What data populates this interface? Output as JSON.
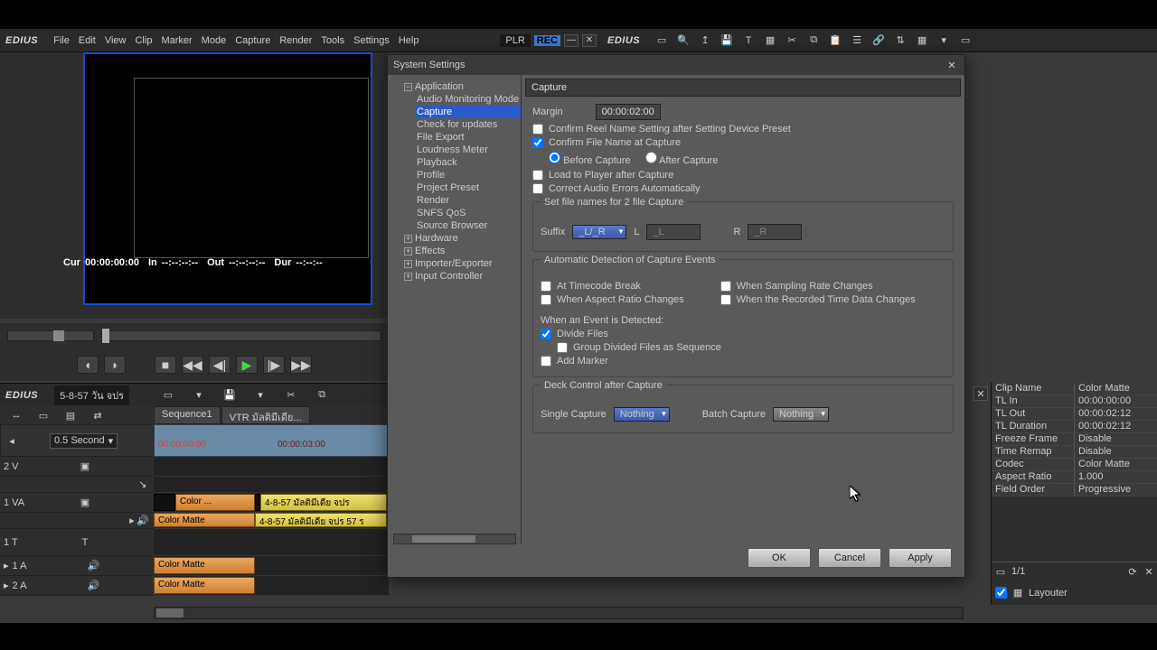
{
  "app": {
    "brand": "EDIUS"
  },
  "menu": [
    "File",
    "Edit",
    "View",
    "Clip",
    "Marker",
    "Mode",
    "Capture",
    "Render",
    "Tools",
    "Settings",
    "Help"
  ],
  "titlebar": {
    "plr": "PLR",
    "rec": "REC"
  },
  "preview": {
    "cur_lbl": "Cur",
    "cur": "00:00:00:00",
    "in_lbl": "In",
    "in": "--:--:--:--",
    "out_lbl": "Out",
    "out": "--:--:--:--",
    "dur_lbl": "Dur",
    "dur": "--:--:--"
  },
  "project": {
    "name": "5-8-57 วัน จปร"
  },
  "sequence_tabs": [
    "Sequence1",
    "VTR มัลติมีเดีย..."
  ],
  "zoom": "0.5 Second",
  "ruler": {
    "t0": "00:00:00:00",
    "t1": "00:00:03:00"
  },
  "tracks": {
    "v2": "2 V",
    "va1": "1 VA",
    "t1": "1 T",
    "a1": "1 A",
    "a2": "2 A"
  },
  "clips": {
    "color_short": "Color ...",
    "color_matte": "Color Matte",
    "yellow1": "4-8-57 มัลติมีเดีย จปร",
    "yellow2": "4-8-57 มัลติมีเดีย จปร 57 ร"
  },
  "info": {
    "title": "Clip Name",
    "pairs": [
      [
        "Clip Name",
        "Color Matte"
      ],
      [
        "TL In",
        "00:00:00:00"
      ],
      [
        "TL Out",
        "00:00:02:12"
      ],
      [
        "TL Duration",
        "00:00:02:12"
      ],
      [
        "Freeze Frame",
        "Disable"
      ],
      [
        "Time Remap",
        "Disable"
      ],
      [
        "Codec",
        "Color Matte"
      ],
      [
        "Aspect Ratio",
        "1.000"
      ],
      [
        "Field Order",
        "Progressive"
      ]
    ],
    "page": "1/1",
    "layouter_chk": true,
    "layouter": "Layouter"
  },
  "dialog": {
    "title": "System Settings",
    "tree": {
      "application": "Application",
      "items": [
        "Audio Monitoring Mode",
        "Capture",
        "Check for updates",
        "File Export",
        "Loudness Meter",
        "Playback",
        "Profile",
        "Project Preset",
        "Render",
        "SNFS QoS",
        "Source Browser"
      ],
      "sel_index": 1,
      "hardware": "Hardware",
      "effects": "Effects",
      "importer": "Importer/Exporter",
      "input": "Input Controller"
    },
    "panel": {
      "heading": "Capture",
      "margin_lbl": "Margin",
      "margin": "00:00:02:00",
      "confirm_reel": "Confirm Reel Name Setting after Setting Device Preset",
      "confirm_file": "Confirm File Name at Capture",
      "before": "Before Capture",
      "after": "After Capture",
      "load_player": "Load to Player after Capture",
      "correct_audio": "Correct Audio Errors Automatically",
      "section_2file": "Set file names for 2 file Capture",
      "suffix_lbl": "Suffix",
      "suffix_val": "_L/_R",
      "L": "L",
      "R": "R",
      "L_val": "_L",
      "R_val": "_R",
      "section_auto": "Automatic Detection of Capture Events",
      "at_tc": "At Timecode Break",
      "aspect": "When Aspect Ratio Changes",
      "sampling": "When Sampling Rate Changes",
      "rectime": "When the Recorded Time Data Changes",
      "when_event": "When an Event is Detected:",
      "divide": "Divide Files",
      "group": "Group Divided Files as Sequence",
      "addmarker": "Add Marker",
      "section_deck": "Deck Control after Capture",
      "single_lbl": "Single Capture",
      "single_val": "Nothing",
      "batch_lbl": "Batch Capture",
      "batch_val": "Nothing"
    },
    "buttons": {
      "ok": "OK",
      "cancel": "Cancel",
      "apply": "Apply"
    }
  }
}
